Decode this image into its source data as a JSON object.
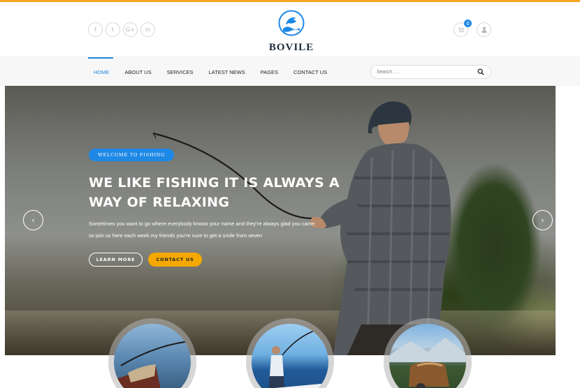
{
  "header": {
    "brand": "BOVILE",
    "social": [
      {
        "icon": "facebook-icon",
        "glyph": "f"
      },
      {
        "icon": "twitter-icon",
        "glyph": "t"
      },
      {
        "icon": "google-plus-icon",
        "glyph": "G+"
      },
      {
        "icon": "linkedin-icon",
        "glyph": "in"
      }
    ],
    "cart_count": "0"
  },
  "nav": {
    "items": [
      {
        "label": "HOME"
      },
      {
        "label": "ABOUT US"
      },
      {
        "label": "SERVICES"
      },
      {
        "label": "LATEST NEWS"
      },
      {
        "label": "PAGES"
      },
      {
        "label": "CONTACT US"
      }
    ],
    "active_index": 0,
    "search_placeholder": "Search . . ."
  },
  "hero": {
    "pill": "WELCOME TO FISHING",
    "title_line1": "WE LIKE FISHING IT IS ALWAYS A",
    "title_line2": "WAY OF RELAXING",
    "subtitle_line1": "Sometimes you want to go where everybody knows your name and they're always glad you came",
    "subtitle_line2": "so join us here each week my friends you're sure to get a smile from seven",
    "btn_learn": "LEARN MORE",
    "btn_contact": "CONTACT US",
    "prev_arrow": "‹",
    "next_arrow": "›"
  },
  "colors": {
    "accent_blue": "#1e88e5",
    "accent_orange": "#f5a800",
    "top_bar": "#f5a623"
  }
}
